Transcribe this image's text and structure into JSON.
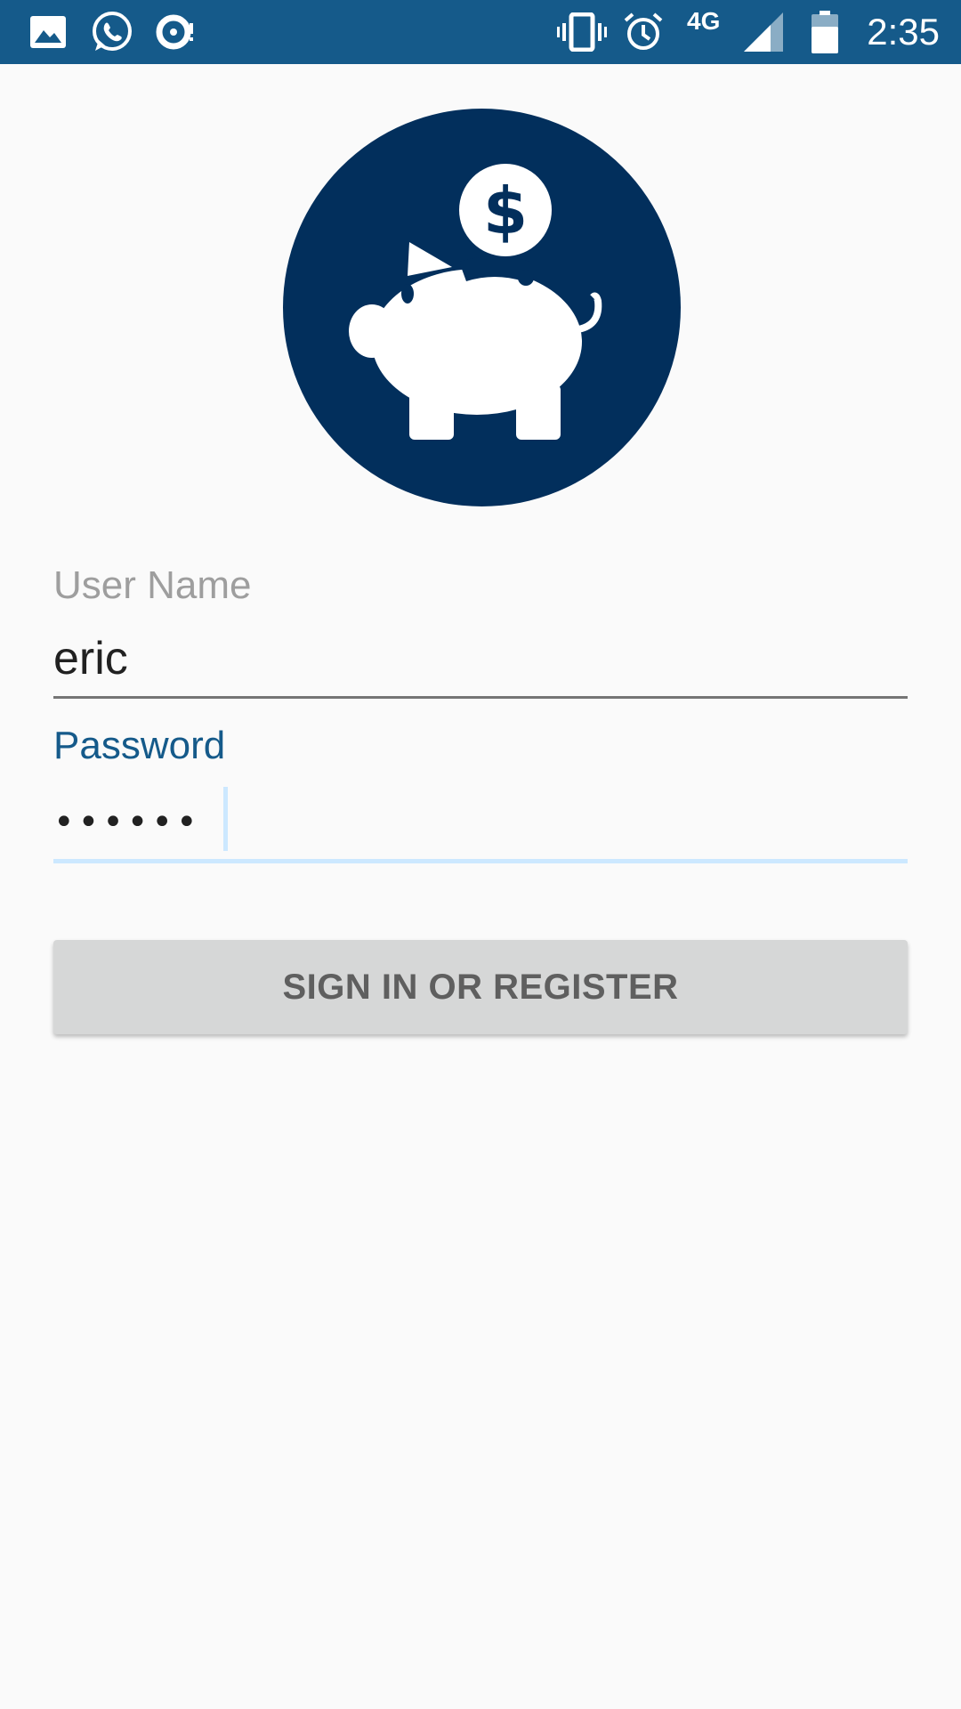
{
  "status_bar": {
    "time": "2:35",
    "network": "4G",
    "icons": [
      "gallery-icon",
      "whatsapp-icon",
      "sync-icon",
      "vibrate-icon",
      "alarm-icon",
      "signal-icon",
      "battery-icon"
    ],
    "background_color": "#155a8a"
  },
  "logo": {
    "icon": "piggy-bank-icon",
    "circle_color": "#022f5c"
  },
  "form": {
    "username_label": "User Name",
    "username_value": "eric",
    "password_label": "Password",
    "password_masked": "••••••",
    "accent_color": "#155a8a"
  },
  "signin_button": {
    "label": "SIGN IN OR REGISTER"
  }
}
